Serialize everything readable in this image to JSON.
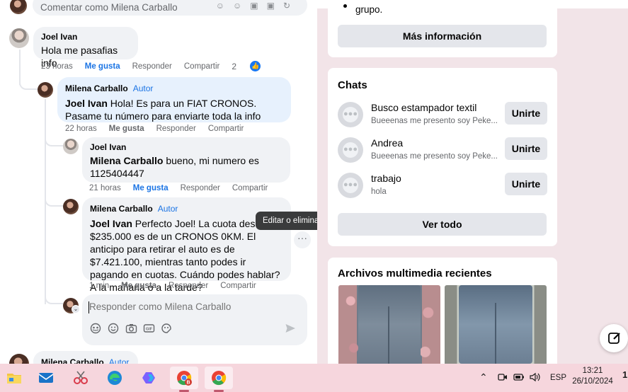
{
  "top_partial": {
    "placeholder": "Comentar como Milena Carballo"
  },
  "comments": [
    {
      "author": "Joel Ivan",
      "text": "Hola me pasafias info",
      "time": "23 horas",
      "like": "Me gusta",
      "reply": "Responder",
      "share": "Compartir",
      "like_count": "2"
    },
    {
      "author": "Milena Carballo",
      "badge": "Autor",
      "mention": "Joel Ivan",
      "text": " Hola! Es para un FIAT CRONOS. Pasame tu número para enviarte toda la info",
      "time": "22 horas",
      "like": "Me gusta",
      "reply": "Responder",
      "share": "Compartir"
    },
    {
      "author": "Joel Ivan",
      "mention": "Milena Carballo",
      "text": " bueno, mi numero es 1125404447",
      "time": "21 horas",
      "like": "Me gusta",
      "reply": "Responder",
      "share": "Compartir"
    },
    {
      "author": "Milena Carballo",
      "badge": "Autor",
      "mention": "Joel Ivan",
      "text": " Perfecto Joel! La cuota desde $235.000 es de un CRONOS 0KM. El anticipo para retirar el auto es de $7.421.100, mientras tanto podes ir pagando en cuotas. Cuándo podes hablar? A la mañana o a la tarde?",
      "time": "1 min",
      "like": "Me gusta",
      "reply": "Responder",
      "share": "Compartir"
    }
  ],
  "tooltip": "Editar o eliminar esto",
  "more_options": "···",
  "reply_box": {
    "placeholder": "Responder como Milena Carballo"
  },
  "bottom_partial": {
    "author": "Milena Carballo",
    "badge": "Autor"
  },
  "right_panel": {
    "group_text": "grupo.",
    "more_info_button": "Más información",
    "chats": {
      "title": "Chats",
      "items": [
        {
          "name": "Busco estampador textil",
          "preview": "Bueeenas me presento soy Peke...",
          "action": "Unirte"
        },
        {
          "name": "Andrea",
          "preview": "Bueeenas me presento soy Peke...",
          "action": "Unirte"
        },
        {
          "name": "trabajo",
          "preview": "hola",
          "action": "Unirte"
        }
      ],
      "see_all": "Ver todo"
    },
    "media": {
      "title": "Archivos multimedia recientes"
    }
  },
  "taskbar": {
    "language": "ESP",
    "time": "13:21",
    "date": "26/10/2024",
    "notification_badge": "1"
  },
  "colors": {
    "accent": "#1b74e4",
    "taskbar": "#f6d6dd",
    "right_bg": "#f2e4e8"
  }
}
